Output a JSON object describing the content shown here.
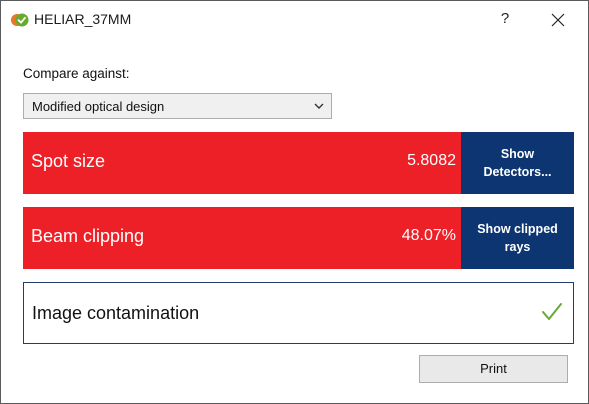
{
  "window": {
    "title": "HELIAR_37MM",
    "help_label": "?"
  },
  "compare": {
    "label": "Compare against:",
    "selected": "Modified optical design"
  },
  "results": {
    "spot": {
      "label": "Spot size",
      "value": "5.8082",
      "action": "Show Detectors...",
      "status": "fail"
    },
    "clip": {
      "label": "Beam clipping",
      "value": "48.07%",
      "action": "Show clipped rays",
      "status": "fail"
    },
    "contam": {
      "label": "Image contamination",
      "status": "pass"
    }
  },
  "footer": {
    "print_label": "Print"
  },
  "colors": {
    "fail": "#ee2027",
    "action": "#0c3572",
    "pass_check": "#6aa832",
    "pass_border": "#1f3d6e"
  },
  "icons": {
    "app": "heliar-app-icon",
    "close": "close-icon",
    "chevron": "chevron-down-icon",
    "check": "check-icon"
  }
}
